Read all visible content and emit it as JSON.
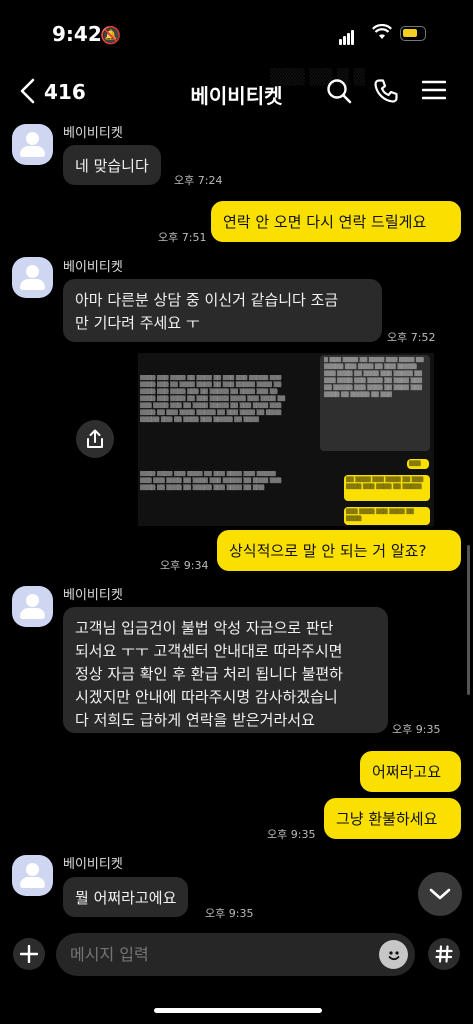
{
  "status_bar": {
    "time": "9:42"
  },
  "header": {
    "count": "416",
    "title": "베이비티켓"
  },
  "messages": {
    "m1": {
      "sender": "베이비티켓",
      "text": "네 맞습니다",
      "time": "오후 7:24"
    },
    "m2": {
      "text": "연락 안 오면 다시 연락 드릴게요",
      "time": "오후 7:51"
    },
    "m3": {
      "sender": "베이비티켓",
      "line1": "아마 다른분 상담 중 이신거 같습니다 조금",
      "line2": "만 기다려 주세요 ㅜ",
      "time": "오후 7:52"
    },
    "m4": {
      "text": "상식적으로 말 안 되는 거 알죠?",
      "time": "오후 9:34"
    },
    "m5": {
      "sender": "베이비티켓",
      "line1": "고객님 입금건이 불법 악성 자금으로 판단",
      "line2": "되서요 ㅜㅜ 고객센터 안내대로 따라주시면",
      "line3": "정상 자금 확인 후 환급 처리 됩니다 불편하",
      "line4": "시겠지만 안내에 따라주시명 감사하겠습니",
      "line5": "다 저희도 급하게 연락을 받은거라서요",
      "time": "오후 9:35"
    },
    "m6": {
      "text": "어쩌라고요"
    },
    "m7": {
      "text": "그냥 환불하세요",
      "time": "오후 9:35"
    },
    "m8": {
      "sender": "베이비티켓",
      "text": "뭘 어쩌라고에요",
      "time": "오후 9:35"
    }
  },
  "input": {
    "placeholder": "메시지 입력"
  }
}
